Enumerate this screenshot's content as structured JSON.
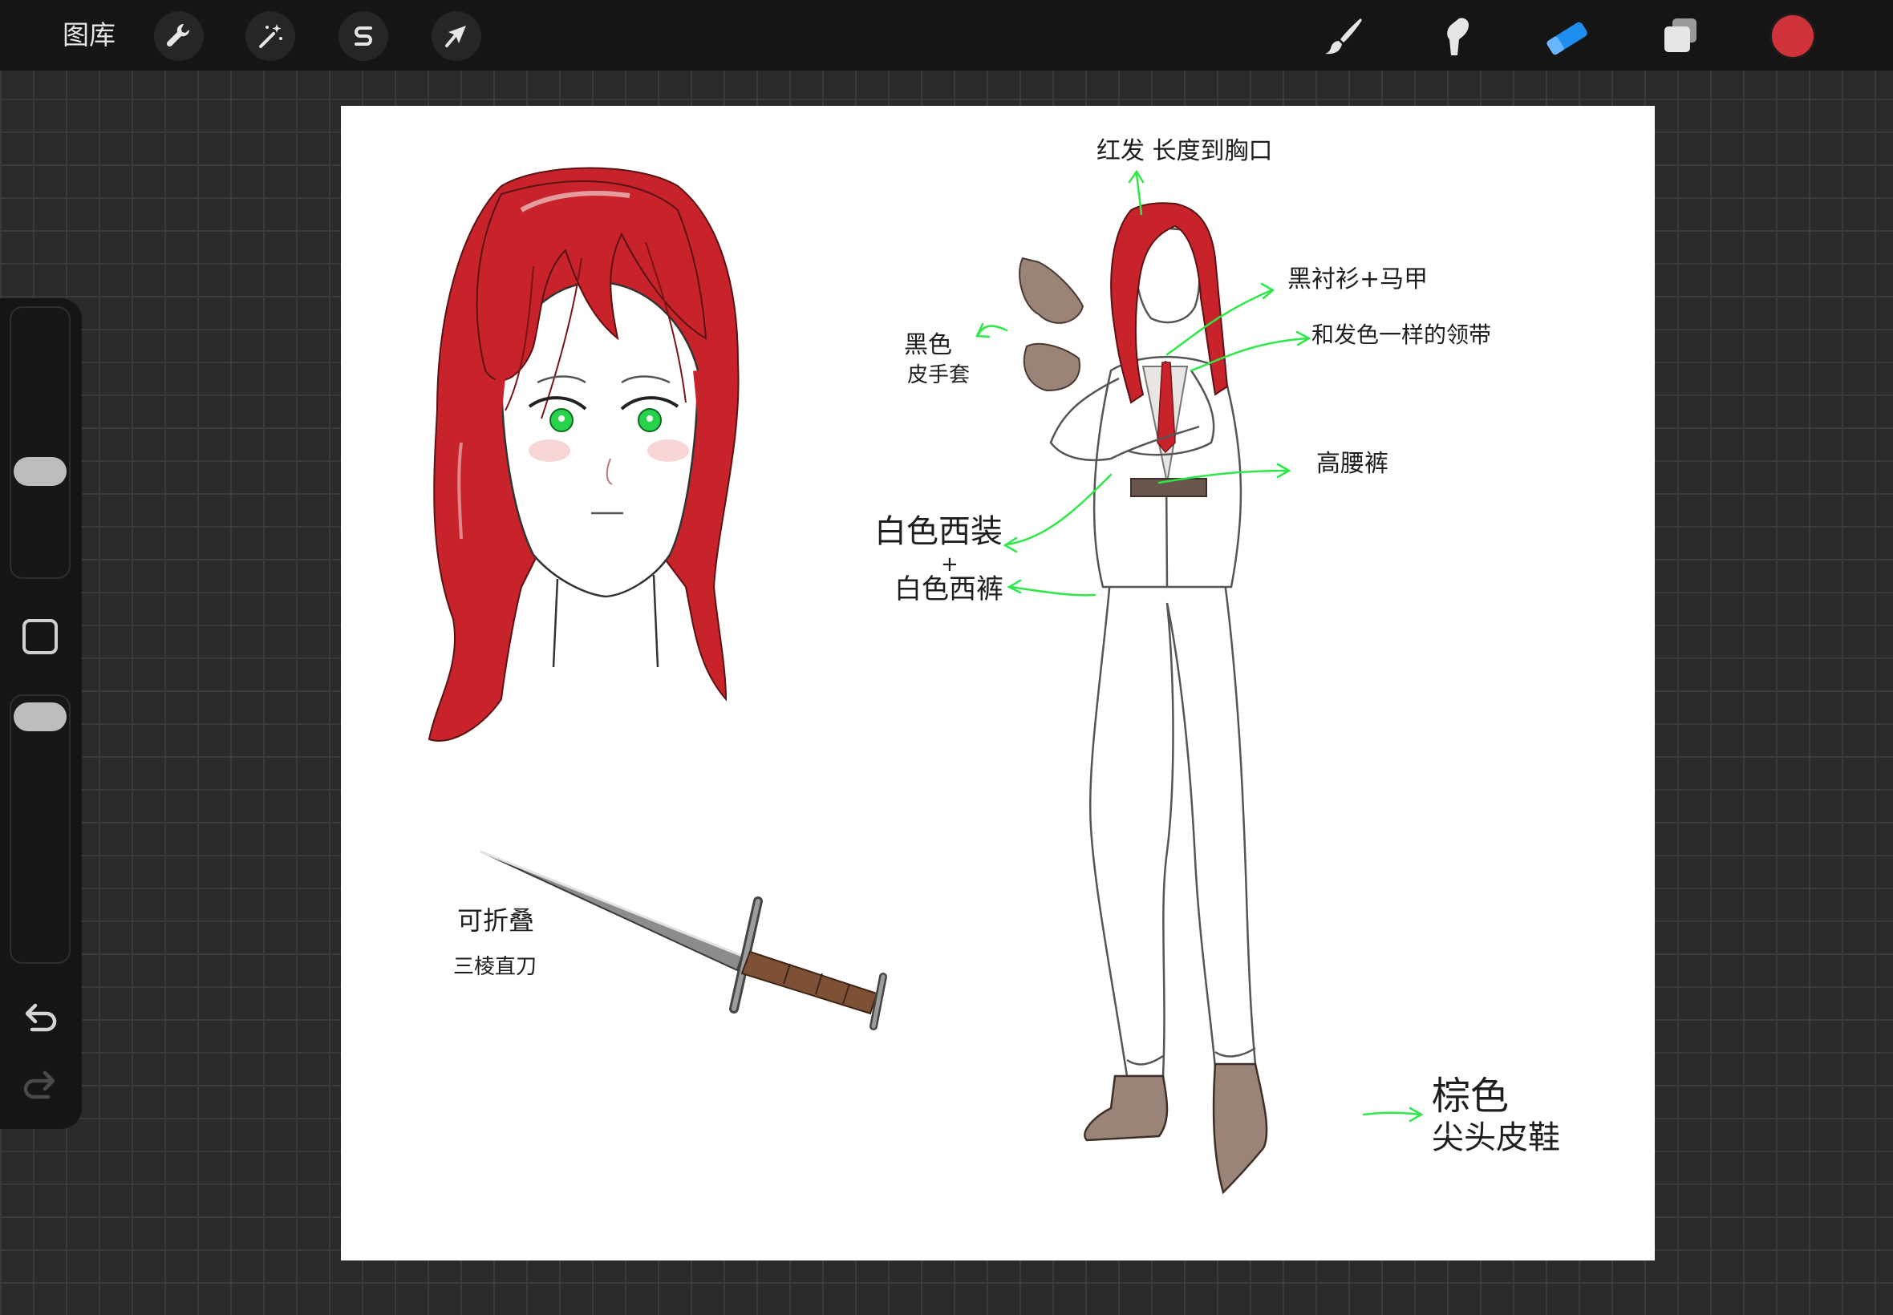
{
  "topbar": {
    "gallery_label": "图库",
    "left_tools": [
      "wrench-icon",
      "magic-wand-icon",
      "selection-s-icon",
      "move-arrow-icon"
    ],
    "right_tools": [
      "brush-icon",
      "smudge-icon",
      "eraser-icon",
      "layers-icon"
    ],
    "active_tool": "eraser-icon",
    "current_color": "#d1333a",
    "eraser_color": "#1f8ef1"
  },
  "sidebar": {
    "controls": [
      "brush-size-slider",
      "modify-square-button",
      "opacity-slider",
      "undo-icon",
      "redo-icon"
    ]
  },
  "canvas": {
    "annotations": {
      "hair": "红发 长度到胸口",
      "shirt_vest": "黑衬衫+马甲",
      "tie": "和发色一样的领带",
      "gloves_line1": "黑色",
      "gloves_line2": "皮手套",
      "high_waist": "高腰裤",
      "suit_line1": "白色西装",
      "suit_plus": "+",
      "suit_line2": "白色西裤",
      "knife_line1": "可折叠",
      "knife_line2": "三棱直刀",
      "shoes_line1": "棕色",
      "shoes_line2": "尖头皮鞋"
    },
    "colors": {
      "hair": "#c8232a",
      "eyes": "#27d34a",
      "arrows": "#2ee84a",
      "leather": "#9a8478"
    }
  }
}
